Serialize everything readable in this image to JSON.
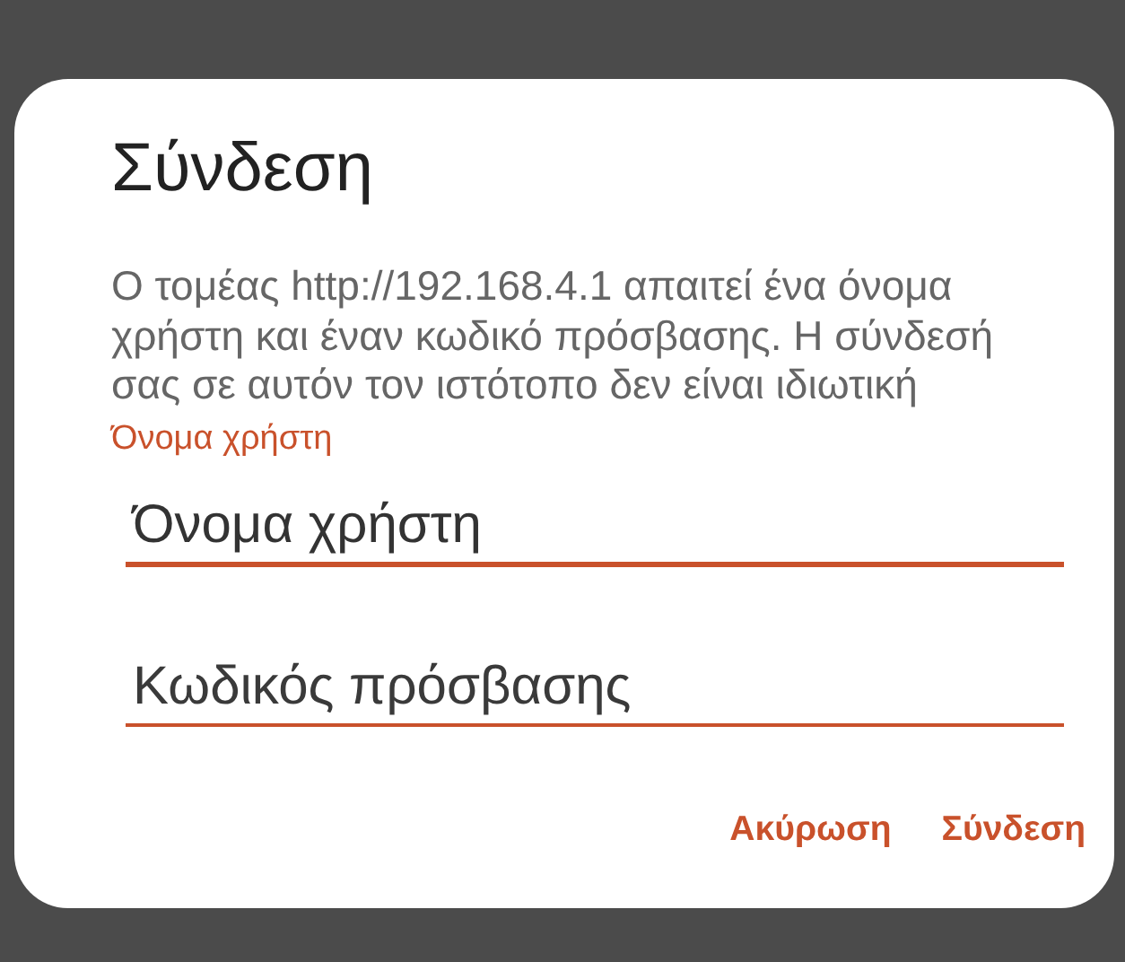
{
  "dialog": {
    "title": "Σύνδεση",
    "message": "Ο τομέας http://192.168.4.1 απαιτεί ένα όνομα χρήστη και έναν κωδικό πρόσβασης. Η σύνδεσή σας σε αυτόν τον ιστότοπο δεν είναι ιδιωτική",
    "fields": [
      {
        "label": "Όνομα χρήστη",
        "value": "Όνομα χρήστη",
        "focused": true
      },
      {
        "placeholder": "Κωδικός πρόσβασης",
        "focused": false
      }
    ],
    "buttons": [
      "Ακύρωση",
      "Σύνδεση"
    ]
  }
}
